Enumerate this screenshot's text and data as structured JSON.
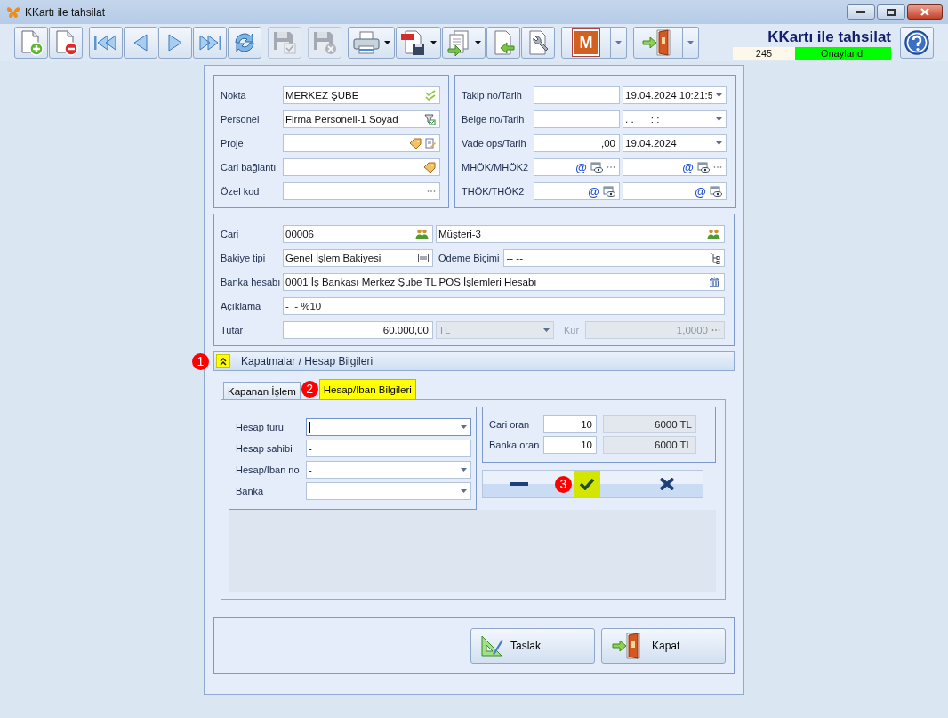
{
  "window": {
    "title": "KKartı ile tahsilat"
  },
  "toolbar": {
    "groups": [
      [
        {
          "kind": "new",
          "disabled": false,
          "has_menu": false
        },
        {
          "kind": "delete",
          "disabled": false,
          "has_menu": false
        }
      ],
      [
        {
          "kind": "first",
          "disabled": false,
          "has_menu": false
        },
        {
          "kind": "prev",
          "disabled": false,
          "has_menu": false
        },
        {
          "kind": "next",
          "disabled": false,
          "has_menu": false
        },
        {
          "kind": "last",
          "disabled": false,
          "has_menu": false
        },
        {
          "kind": "refresh",
          "disabled": false,
          "has_menu": false
        }
      ],
      [
        {
          "kind": "save",
          "disabled": true,
          "has_menu": false
        }
      ],
      [
        {
          "kind": "discard",
          "disabled": true,
          "has_menu": false
        }
      ],
      [
        {
          "kind": "print",
          "disabled": false,
          "has_menu": true,
          "split_menu": false
        },
        {
          "kind": "pdf",
          "disabled": false,
          "has_menu": true,
          "split_menu": false
        },
        {
          "kind": "export",
          "disabled": false,
          "has_menu": true,
          "split_menu": false
        },
        {
          "kind": "import",
          "disabled": false,
          "has_menu": false
        },
        {
          "kind": "tools",
          "disabled": false,
          "has_menu": false
        }
      ],
      [
        {
          "kind": "m",
          "label": "M",
          "disabled": false,
          "has_menu": true,
          "split_menu": true
        }
      ],
      [
        {
          "kind": "exit",
          "disabled": false,
          "has_menu": true,
          "split_menu": true
        }
      ]
    ]
  },
  "header": {
    "title": "KKartı ile tahsilat",
    "record_no": "245",
    "status": "Onaylandı"
  },
  "general": [
    {
      "label": "Nokta",
      "value": "MERKEZ ŞUBE"
    },
    {
      "label": "Personel",
      "value": "Firma Personeli-1 Soyad"
    },
    {
      "label": "Proje"
    },
    {
      "label": "Cari bağlantı"
    },
    {
      "label": "Özel kod"
    }
  ],
  "tracking": [
    {
      "label": "Takip no/Tarih",
      "kind": "date",
      "second": {
        "value": "19.04.2024 10:21:5"
      }
    },
    {
      "label": "Belge no/Tarih",
      "kind": "date",
      "second": {
        "value": ". .      : :"
      }
    },
    {
      "label": "Vade ops/Tarih",
      "kind": "date",
      "first": {
        "value": ",00"
      },
      "second": {
        "value": "19.04.2024"
      }
    },
    {
      "label": "MHÖK/MHÖK2",
      "kind": "link",
      "first": {
        "mark": "@"
      },
      "second": {
        "mark": "@"
      }
    },
    {
      "label": "THÖK/THÖK2",
      "kind": "link2",
      "first": {
        "mark": "@"
      },
      "second": {
        "mark": "@"
      }
    }
  ],
  "payment": {
    "cari": {
      "label": "Cari",
      "code": "00006",
      "name": "Müşteri-3"
    },
    "balance": {
      "label": "Bakiye tipi",
      "value": "Genel İşlem Bakiyesi",
      "method_label": "Ödeme Biçimi",
      "method": "-- --"
    },
    "bank": {
      "label": "Banka hesabı",
      "value": "0001 İş Bankası Merkez Şube TL POS İşlemleri Hesabı"
    },
    "note": {
      "label": "Açıklama",
      "value": "-  - %10"
    },
    "amount": {
      "label": "Tutar",
      "value": "60.000,00",
      "currency": "TL",
      "currency_disabled": true,
      "rate_label": "Kur",
      "rate": "1,0000",
      "rate_disabled": true
    }
  },
  "section": {
    "title": "Kapatmalar / Hesap Bilgileri",
    "expanded": true,
    "highlighted": true,
    "callout": "1"
  },
  "tabs": [
    {
      "label": "Kapanan İşlem",
      "selected": false,
      "highlighted": false
    },
    {
      "label": "Hesap/Iban Bilgileri",
      "selected": true,
      "highlighted": true,
      "callout": "2"
    }
  ],
  "account": [
    {
      "label": "Hesap türü",
      "kind": "combo",
      "focused": true
    },
    {
      "label": "Hesap sahibi",
      "kind": "text",
      "value": "-",
      "focused": false
    },
    {
      "label": "Hesap/Iban no",
      "kind": "combo",
      "value": "-",
      "focused": false
    },
    {
      "label": "Banka",
      "kind": "combo",
      "focused": false
    }
  ],
  "ratios": [
    {
      "label": "Cari oran",
      "value": "10",
      "result": "6000 TL"
    },
    {
      "label": "Banka oran",
      "value": "10",
      "result": "6000 TL"
    }
  ],
  "actions": [
    {
      "kind": "remove",
      "highlighted": false
    },
    {
      "kind": "confirm",
      "highlighted": true,
      "callout": "3"
    },
    {
      "kind": "cancel",
      "highlighted": false
    }
  ],
  "buttons": [
    {
      "kind": "draft",
      "label": "Taslak"
    },
    {
      "kind": "close",
      "label": "Kapat"
    }
  ]
}
